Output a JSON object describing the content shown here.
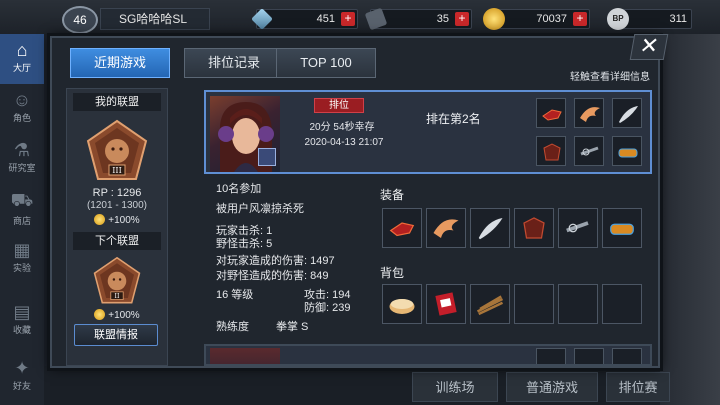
{
  "topbar": {
    "level": "46",
    "player_name": "SG哈哈哈SL",
    "currencies": [
      {
        "icon": "diamond-icon",
        "value": "451",
        "color": "#7fb2cf"
      },
      {
        "icon": "ticket-icon",
        "value": "35",
        "color": "#9aa4ae"
      },
      {
        "icon": "gold-coin-icon",
        "value": "70037",
        "color": "#e2a51c"
      },
      {
        "icon": "bp-icon",
        "value": "311",
        "color": "#c8cdd2"
      }
    ]
  },
  "side_nav": [
    {
      "label": "大厅",
      "icon": "home-icon"
    },
    {
      "label": "角色",
      "icon": "character-icon"
    },
    {
      "label": "研究室",
      "icon": "flask-icon"
    },
    {
      "label": "商店",
      "icon": "cart-icon"
    },
    {
      "label": "实验",
      "icon": "building-icon"
    },
    {
      "label": "收藏",
      "icon": "book-icon"
    },
    {
      "label": "好友",
      "icon": "gamepad-icon"
    }
  ],
  "bottom_buttons": [
    "训练场",
    "普通游戏",
    "排位赛"
  ],
  "modal": {
    "tabs": [
      "近期游戏",
      "排位记录",
      "TOP 100"
    ],
    "hint": "轻触查看详细信息",
    "league": {
      "my_league_title": "我的联盟",
      "current_tier": "III",
      "rp": "RP : 1296",
      "rp_range": "(1201 - 1300)",
      "bonus": "+100%",
      "next_league_title": "下个联盟",
      "next_tier": "II",
      "next_bonus": "+100%",
      "info_button": "联盟情报"
    },
    "match": {
      "mode": "排位",
      "survival": "20分 54秒幸存",
      "date": "2020-04-13 21:07",
      "rank": "排在第2名",
      "participants": "10名参加",
      "killed_by": "被用户风凛掠杀死",
      "player_kills": "玩家击杀: 1",
      "monster_kills": "野怪击杀: 5",
      "damage_players": "对玩家造成的伤害: 1497",
      "damage_monsters": "对野怪造成的伤害: 849",
      "level": "16 等级",
      "attack": "攻击: 194",
      "defense": "防御: 239",
      "mastery_label": "熟练度",
      "mastery_value": "拳掌 S",
      "equipment_title": "装备",
      "bag_title": "背包",
      "equipment": [
        "gauntlet-icon",
        "wing-icon",
        "feather-icon",
        "armor-icon",
        "chain-icon",
        "bracer-icon"
      ],
      "bag": [
        "bread-icon",
        "card-icon",
        "sticks-icon",
        "",
        "",
        ""
      ]
    }
  }
}
